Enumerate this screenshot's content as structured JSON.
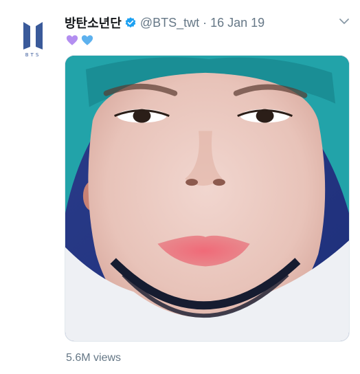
{
  "tweet": {
    "display_name": "방탄소년단",
    "handle": "@BTS_twt",
    "separator": "·",
    "date": "16 Jan 19",
    "views": "5.6M views",
    "emojis": [
      "purple-heart",
      "blue-heart"
    ],
    "verified": true
  },
  "avatar": {
    "icon": "bts-logo-icon",
    "logo_text": "BTS",
    "color": "#3a5a9a"
  },
  "colors": {
    "verified": "#1da1f2",
    "muted": "#657786",
    "name": "#14171a",
    "purple_heart": "#b38ef0",
    "blue_heart": "#5db1ee"
  }
}
